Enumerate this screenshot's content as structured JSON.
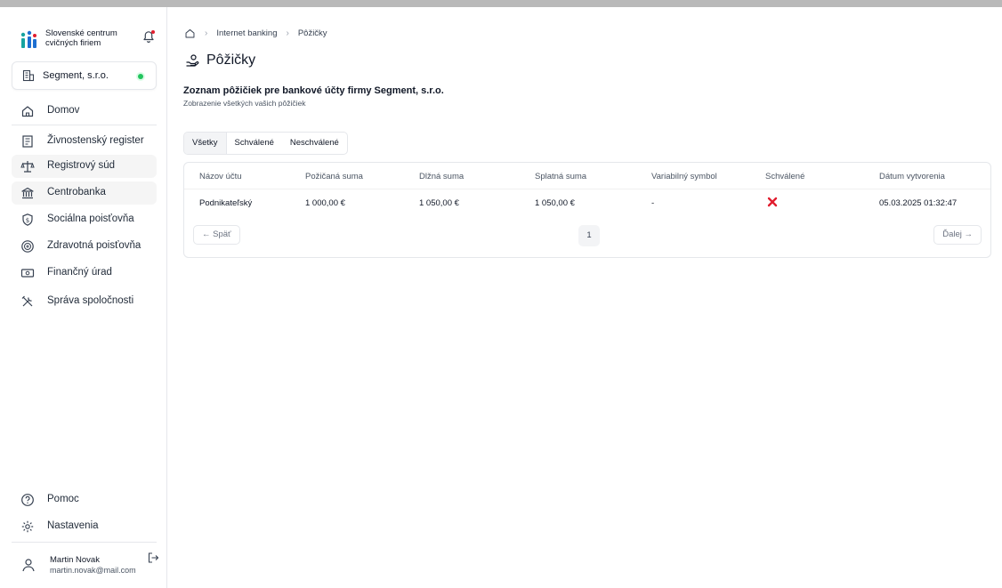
{
  "brand": {
    "line1": "Slovenské centrum",
    "line2": "cvičných firiem",
    "logo_icon": "scf-logo-icon",
    "bell_icon": "bell-icon"
  },
  "company": {
    "name": "Segment, s.r.o.",
    "status_color": "#22c55e"
  },
  "nav": {
    "items": [
      {
        "label": "Domov",
        "icon": "home-icon"
      },
      {
        "label": "Živnostenský register",
        "icon": "register-icon"
      },
      {
        "label": "Registrový súd",
        "icon": "scales-icon"
      },
      {
        "label": "Centrobanka",
        "icon": "bank-icon"
      },
      {
        "label": "Sociálna poisťovňa",
        "icon": "shield-icon"
      },
      {
        "label": "Zdravotná poisťovňa",
        "icon": "health-icon"
      },
      {
        "label": "Finančný úrad",
        "icon": "cash-icon"
      },
      {
        "label": "Správa spoločnosti",
        "icon": "tools-icon"
      }
    ],
    "bottom": [
      {
        "label": "Pomoc",
        "icon": "help-icon"
      },
      {
        "label": "Nastavenia",
        "icon": "gear-icon"
      }
    ]
  },
  "user": {
    "name": "Martin Novak",
    "email": "martin.novak@mail.com"
  },
  "breadcrumb": {
    "items": [
      "Internet banking",
      "Pôžičky"
    ]
  },
  "page": {
    "title": "Pôžičky",
    "list_title": "Zoznam pôžičiek pre bankové účty firmy Segment, s.r.o.",
    "list_subtitle": "Zobrazenie všetkých vašich pôžičiek"
  },
  "filters": [
    "Všetky",
    "Schválené",
    "Neschválené"
  ],
  "table": {
    "columns": [
      "Názov účtu",
      "Požičaná suma",
      "Dlžná suma",
      "Splatná suma",
      "Variabilný symbol",
      "Schválené",
      "Dátum vytvorenia"
    ],
    "rows": [
      {
        "account": "Podnikateľský",
        "borrowed": "1 000,00 €",
        "owed": "1 050,00 €",
        "due": "1 050,00 €",
        "vs": "-",
        "approved_icon": "cross-icon",
        "created": "05.03.2025 01:32:47"
      }
    ]
  },
  "pagination": {
    "prev": "Späť",
    "page": "1",
    "next": "Ďalej"
  },
  "colors": {
    "accent_red": "#e11d2e",
    "brand_blue": "#1d6fd1",
    "brand_teal": "#16a3a0"
  }
}
